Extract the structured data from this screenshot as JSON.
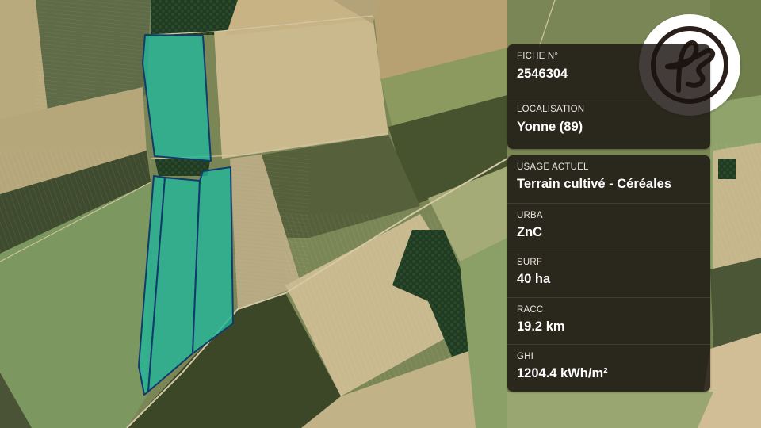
{
  "map": {
    "parcel_fill": "#1fb89a",
    "parcel_stroke": "#123a6b"
  },
  "brand": {
    "logo_text": "fs"
  },
  "fiche": {
    "number_label": "FICHE N°",
    "number_value": "2546304",
    "location_label": "LOCALISATION",
    "location_value": "Yonne (89)"
  },
  "details": {
    "usage_label": "USAGE ACTUEL",
    "usage_value": "Terrain cultivé - Céréales",
    "urba_label": "URBA",
    "urba_value": "ZnC",
    "surf_label": "SURF",
    "surf_value": "40 ha",
    "racc_label": "RACC",
    "racc_value": "19.2 km",
    "ghi_label": "GHI",
    "ghi_value": "1204.4 kWh/m²"
  }
}
